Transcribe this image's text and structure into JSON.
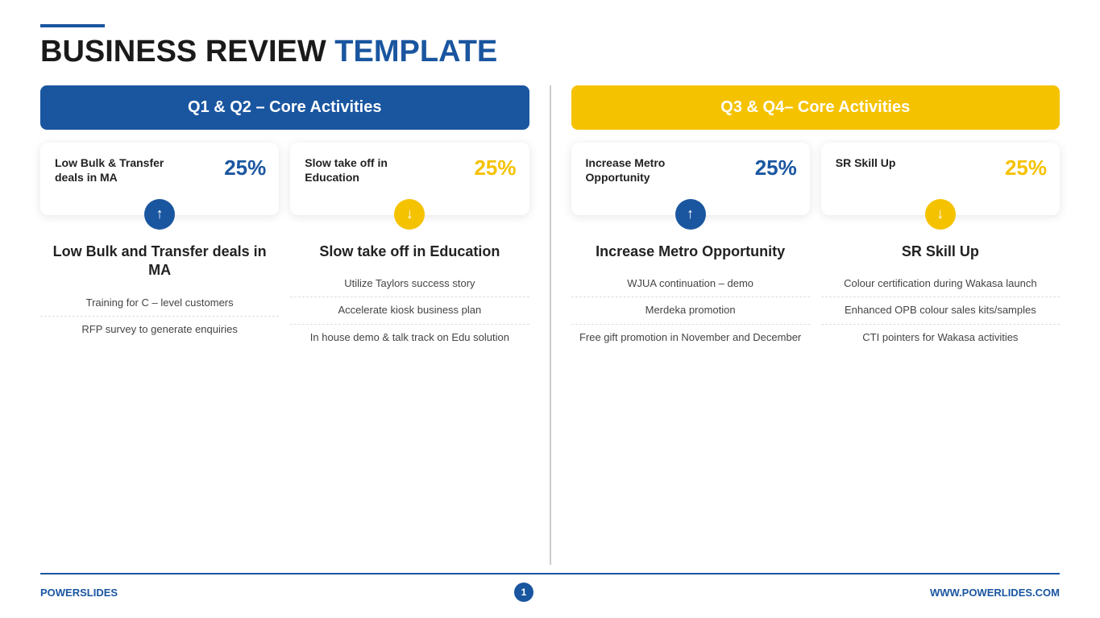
{
  "header": {
    "line": true,
    "title_black": "BUSINESS REVIEW",
    "title_blue": "TEMPLATE"
  },
  "left_section": {
    "header": "Q1 & Q2 – Core Activities",
    "header_color": "blue",
    "cards": [
      {
        "title": "Low Bulk & Transfer deals in MA",
        "percent": "25%",
        "percent_color": "blue",
        "icon_color": "blue",
        "icon_direction": "up"
      },
      {
        "title": "Slow take off in Education",
        "percent": "25%",
        "percent_color": "yellow",
        "icon_color": "yellow",
        "icon_direction": "down"
      }
    ],
    "sub_cols": [
      {
        "label": "Low Bulk and Transfer deals in MA",
        "items": [
          "Training for C – level customers",
          "RFP survey to generate enquiries"
        ]
      },
      {
        "label": "Slow take off in Education",
        "items": [
          "Utilize Taylors success story",
          "Accelerate kiosk business plan",
          "In house demo & talk track on Edu solution"
        ]
      }
    ]
  },
  "right_section": {
    "header": "Q3 & Q4– Core Activities",
    "header_color": "yellow",
    "cards": [
      {
        "title": "Increase Metro Opportunity",
        "percent": "25%",
        "percent_color": "blue",
        "icon_color": "blue",
        "icon_direction": "up"
      },
      {
        "title": "SR Skill Up",
        "percent": "25%",
        "percent_color": "yellow",
        "icon_color": "yellow",
        "icon_direction": "down"
      }
    ],
    "sub_cols": [
      {
        "label": "Increase Metro Opportunity",
        "items": [
          "WJUA continuation – demo",
          "Merdeka promotion",
          "Free gift promotion in November and December"
        ]
      },
      {
        "label": "SR Skill Up",
        "items": [
          "Colour certification during Wakasa launch",
          "Enhanced OPB colour sales kits/samples",
          "CTI pointers for Wakasa activities"
        ]
      }
    ]
  },
  "footer": {
    "brand_black": "POWER",
    "brand_blue": "SLIDES",
    "page_number": "1",
    "url": "WWW.POWERLIDES.COM"
  }
}
